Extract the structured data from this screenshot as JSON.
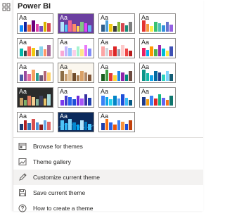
{
  "panel": {
    "section_title": "Power BI"
  },
  "rail": {
    "icon": "theme-gallery-icon"
  },
  "tile_label": "Aa",
  "themes": [
    {
      "bg": "#ffffff",
      "text": "#252423",
      "bars": [
        "#118dff",
        "#12239e",
        "#e66c37",
        "#6b007b",
        "#e044a7",
        "#744ec2",
        "#d9b300",
        "#d64550"
      ]
    },
    {
      "bg": "#6b3fa0",
      "text": "#ffffff",
      "bars": [
        "#b3e5fc",
        "#4fc3f7",
        "#f06292",
        "#ff8a65",
        "#ffd54f",
        "#81c784",
        "#e040fb",
        "#64b5f6"
      ]
    },
    {
      "bg": "#ffffff",
      "text": "#252423",
      "bars": [
        "#2f5d8a",
        "#4c9ed9",
        "#f2c811",
        "#3a3a3a",
        "#8ab833",
        "#d64550",
        "#1e8d78",
        "#7f7f7f"
      ]
    },
    {
      "bg": "#ffffff",
      "text": "#252423",
      "bars": [
        "#e3342f",
        "#f6993f",
        "#ffed4a",
        "#38c172",
        "#4dc0b5",
        "#3490dc",
        "#6574cd",
        "#9561e2"
      ]
    },
    {
      "bg": "#ffffff",
      "text": "#252423",
      "bars": [
        "#01b8aa",
        "#374649",
        "#fd625e",
        "#f2c80f",
        "#5f6b6d",
        "#8ad4eb",
        "#fe9666",
        "#a66999"
      ]
    },
    {
      "bg": "#ffffff",
      "text": "#252423",
      "bars": [
        "#f9a8d4",
        "#c4b5fd",
        "#93c5fd",
        "#fbcfe8",
        "#a7f3d0",
        "#fde68a",
        "#e879f9",
        "#818cf8"
      ]
    },
    {
      "bg": "#ffffff",
      "text": "#252423",
      "bars": [
        "#fca5a5",
        "#d1d5db",
        "#f87171",
        "#dc2626",
        "#9ca3af",
        "#fecaca",
        "#ef4444",
        "#b91c1c"
      ]
    },
    {
      "bg": "#ffffff",
      "text": "#252423",
      "bars": [
        "#e91e63",
        "#03a9f4",
        "#ff9800",
        "#4caf50",
        "#9c27b0",
        "#00bcd4",
        "#ffeb3b",
        "#3f51b5"
      ]
    },
    {
      "bg": "#ffffff",
      "text": "#252423",
      "bars": [
        "#4b5ea8",
        "#9a4c9f",
        "#e06c9f",
        "#f4a261",
        "#2a9d8f",
        "#6d597a",
        "#b56576",
        "#ffd166"
      ]
    },
    {
      "bg": "#fbf7ef",
      "text": "#252423",
      "bars": [
        "#8c6d46",
        "#c59b6d",
        "#e0c097",
        "#6e4b2a",
        "#a67c52",
        "#d9a066",
        "#b08968",
        "#7f5539"
      ]
    },
    {
      "bg": "#ffffff",
      "text": "#252423",
      "bars": [
        "#1b5e20",
        "#43a047",
        "#e53935",
        "#fdd835",
        "#1e88e5",
        "#8e24aa",
        "#00897b",
        "#6d4c41"
      ]
    },
    {
      "bg": "#ffffff",
      "text": "#252423",
      "bars": [
        "#0d9488",
        "#14b8a6",
        "#0ea5e9",
        "#0369a1",
        "#1e3a8a",
        "#2dd4bf",
        "#7dd3fc",
        "#155e75"
      ]
    },
    {
      "bg": "#2b2b2b",
      "text": "#ffffff",
      "bars": [
        "#c8a165",
        "#7fb069",
        "#e07a5f",
        "#f2cc8f",
        "#81b29a",
        "#3d405b",
        "#e9c46a",
        "#a8dadc"
      ]
    },
    {
      "bg": "#ffffff",
      "text": "#252423",
      "bars": [
        "#7c3aed",
        "#4338ca",
        "#2563eb",
        "#1d4ed8",
        "#6d28d9",
        "#a855f7",
        "#3730a3",
        "#1e40af"
      ]
    },
    {
      "bg": "#ffffff",
      "text": "#252423",
      "bars": [
        "#3b82f6",
        "#0ea5e9",
        "#22d3ee",
        "#0284c7",
        "#60a5fa",
        "#1d4ed8",
        "#38bdf8",
        "#075985"
      ]
    },
    {
      "bg": "#ffffff",
      "text": "#252423",
      "bars": [
        "#1e3a8a",
        "#f59e0b",
        "#3b82f6",
        "#dc2626",
        "#10b981",
        "#6366f1",
        "#f97316",
        "#0f766e"
      ]
    },
    {
      "bg": "#ffffff",
      "text": "#252423",
      "bars": [
        "#1f3b73",
        "#b22222",
        "#2f6fb3",
        "#d94f4f",
        "#4a90d9",
        "#8b1a1a",
        "#6aa5e3",
        "#e06666"
      ]
    },
    {
      "bg": "#0b2a5c",
      "text": "#ffffff",
      "bars": [
        "#4fc3f7",
        "#29b6f6",
        "#81d4fa",
        "#0288d1",
        "#03a9f4",
        "#b3e5fc",
        "#0277bd",
        "#40c4ff"
      ],
      "wave": true
    },
    {
      "bg": "#ffffff",
      "text": "#252423",
      "bars": [
        "#1e40af",
        "#f97316",
        "#2563eb",
        "#ea580c",
        "#3b82f6",
        "#fb923c",
        "#1d4ed8",
        "#c2410c"
      ]
    }
  ],
  "bar_heights": [
    0.5,
    0.8,
    0.6,
    0.95,
    0.65,
    0.45,
    0.85,
    0.7
  ],
  "menu": {
    "items": [
      {
        "label": "Browse for themes",
        "icon": "browse-folder-icon"
      },
      {
        "label": "Theme gallery",
        "icon": "gallery-icon"
      },
      {
        "label": "Customize current theme",
        "icon": "paintbrush-edit-icon"
      },
      {
        "label": "Save current theme",
        "icon": "save-icon"
      },
      {
        "label": "How to create a theme",
        "icon": "help-icon"
      }
    ]
  },
  "colors": {
    "accent": "#118dff",
    "hover_bg": "#f3f2f1",
    "tile_border": "#8a8886"
  }
}
